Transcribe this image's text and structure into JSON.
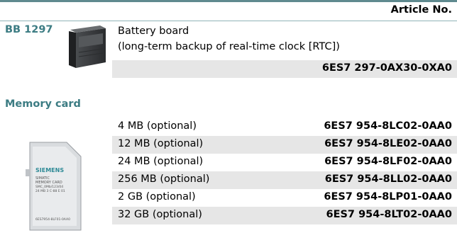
{
  "header": {
    "article_col": "Article No."
  },
  "battery_section": {
    "title": "BB 1297",
    "desc_line1": "Battery board",
    "desc_line2": "(long-term backup of real-time clock [RTC])",
    "article_no": "6ES7 297-0AX30-0XA0"
  },
  "memory_section": {
    "title": "Memory card",
    "card_brand": "SIEMENS",
    "card_line1": "SIMATIC",
    "card_line2": "MEMORY CARD",
    "card_line3": "SMC_0Mb/123/04",
    "card_line4": "24 MB  3 C-88  E 01",
    "card_part": "6ES7954-8LF01-0AA0",
    "rows": [
      {
        "label": "4 MB (optional)",
        "article_no": "6ES7 954-8LC02-0AA0"
      },
      {
        "label": "12 MB (optional)",
        "article_no": "6ES7 954-8LE02-0AA0"
      },
      {
        "label": "24 MB (optional)",
        "article_no": "6ES7 954-8LF02-0AA0"
      },
      {
        "label": "256 MB (optional)",
        "article_no": "6ES7 954-8LL02-0AA0"
      },
      {
        "label": "2 GB (optional)",
        "article_no": "6ES7 954-8LP01-0AA0"
      },
      {
        "label": "32 GB (optional)",
        "article_no": "6ES7 954-8LT02-0AA0"
      }
    ]
  },
  "colors": {
    "accent": "#3c7c83",
    "row_shade": "#e6e6e6",
    "rule": "#5f8a8f"
  }
}
